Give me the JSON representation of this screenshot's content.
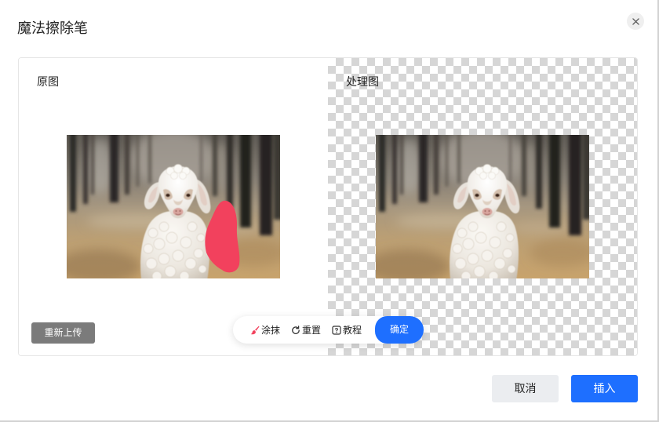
{
  "dialog": {
    "title": "魔法擦除笔",
    "close_icon": "close-icon"
  },
  "original": {
    "label": "原图",
    "reupload_label": "重新上传"
  },
  "processed": {
    "label": "处理图"
  },
  "toolbar": {
    "items": [
      {
        "icon": "brush-icon",
        "label": "涂抹"
      },
      {
        "icon": "reset-icon",
        "label": "重置"
      },
      {
        "icon": "tutorial-icon",
        "label": "教程"
      }
    ],
    "confirm_label": "确定"
  },
  "footer": {
    "cancel_label": "取消",
    "insert_label": "插入"
  },
  "colors": {
    "primary": "#1e6fff",
    "brush": "#f2415d",
    "reupload_bg": "#7b7b7b",
    "cancel_bg": "#ebedf0"
  }
}
